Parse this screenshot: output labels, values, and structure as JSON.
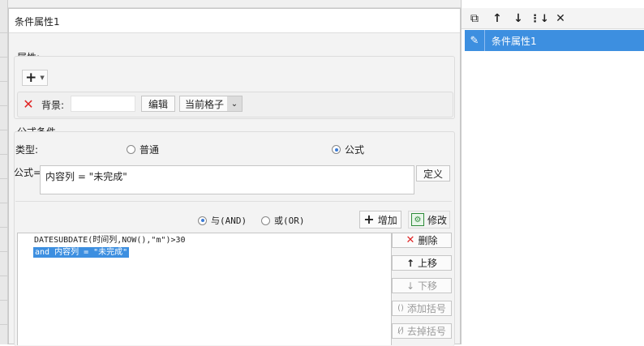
{
  "dialog": {
    "title": "条件属性1",
    "attributes": {
      "group_label": "属性:",
      "add_button": "+",
      "background_label": "背景:",
      "background_value": "",
      "edit_button": "编辑",
      "scope_selected": "当前格子"
    },
    "formula_condition": {
      "group_label": "公式条件",
      "type_label": "类型:",
      "type_options": [
        {
          "label": "普通",
          "selected": false
        },
        {
          "label": "公式",
          "selected": true
        }
      ],
      "formula_label": "公式=",
      "formula_value": "内容列 = \"未完成\"",
      "define_button": "定义",
      "logic_options": [
        {
          "label": "与(AND)",
          "selected": true
        },
        {
          "label": "或(OR)",
          "selected": false
        }
      ],
      "add_button": "增加",
      "modify_button": "修改",
      "conditions": [
        {
          "text": "DATESUBDATE(时间列,NOW(),\"m\")>30",
          "selected": false
        },
        {
          "text": "and 内容列 = \"未完成\"",
          "selected": true
        }
      ],
      "delete_button": "删除",
      "move_up_button": "上移",
      "move_down_button": "下移",
      "add_bracket_button": "添加括号",
      "remove_bracket_button": "去掉括号"
    }
  },
  "right_panel": {
    "items": [
      {
        "label": "条件属性1",
        "selected": true
      }
    ]
  },
  "colors": {
    "accent": "#3d8fe0",
    "selection": "#3d8fe0",
    "delete_red": "#e02424"
  }
}
